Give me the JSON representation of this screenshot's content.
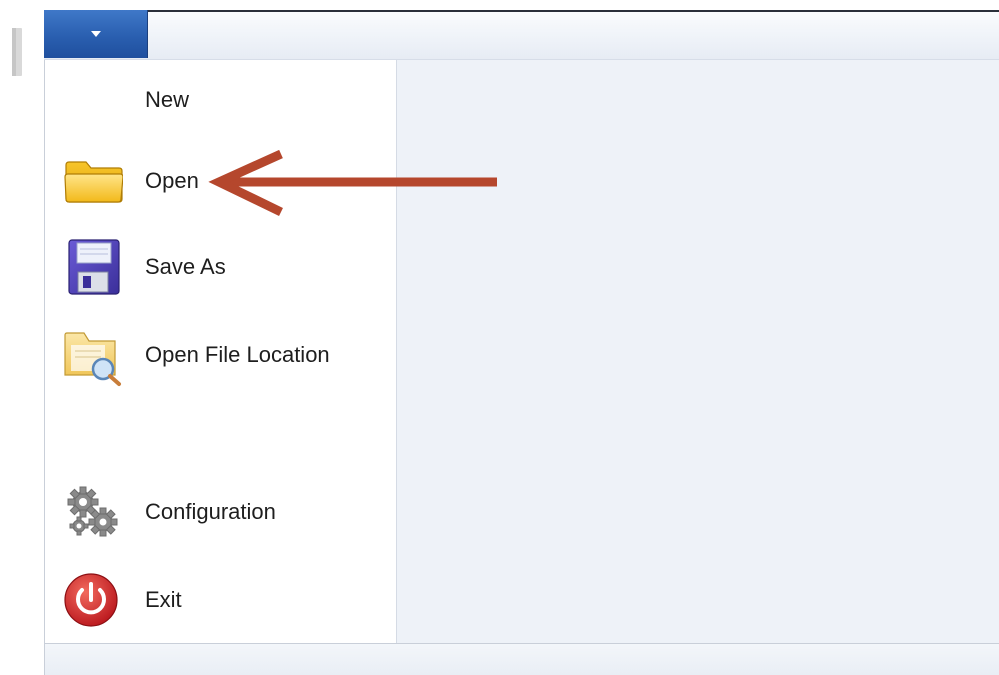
{
  "app_menu": {
    "button_icon": "chevron-down-icon",
    "items": [
      {
        "label": "New",
        "icon": "blank-icon"
      },
      {
        "label": "Open",
        "icon": "folder-icon"
      },
      {
        "label": "Save As",
        "icon": "floppy-disk-icon"
      },
      {
        "label": "Open File Location",
        "icon": "folder-search-icon"
      },
      {
        "label": "Configuration",
        "icon": "gears-icon"
      },
      {
        "label": "Exit",
        "icon": "power-icon"
      }
    ]
  },
  "annotation": {
    "arrow_target": "Open",
    "arrow_color": "#b5472d"
  },
  "colors": {
    "app_button": "#2a5fb0",
    "content_background": "#eef2f8",
    "menu_background": "#ffffff"
  }
}
